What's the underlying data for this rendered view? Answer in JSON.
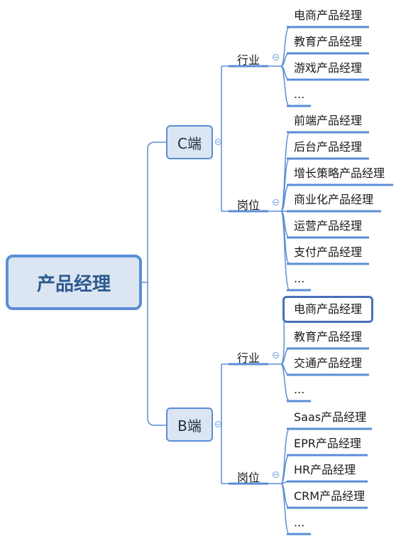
{
  "colors": {
    "line": "#5a8ed6",
    "node_fill": "#dce6f2",
    "root_text": "#2c5a8f",
    "selected_border": "#4a70b8"
  },
  "root": {
    "label": "产品经理"
  },
  "branches": [
    {
      "label": "C端",
      "groups": [
        {
          "label": "行业",
          "items": [
            "电商产品经理",
            "教育产品经理",
            "游戏产品经理",
            "..."
          ]
        },
        {
          "label": "岗位",
          "items": [
            "前端产品经理",
            "后台产品经理",
            "增长策略产品经理",
            "商业化产品经理",
            "运营产品经理",
            "支付产品经理",
            "..."
          ]
        }
      ]
    },
    {
      "label": "B端",
      "groups": [
        {
          "label": "行业",
          "items": [
            "电商产品经理",
            "教育产品经理",
            "交通产品经理",
            "..."
          ],
          "selected_index": 0
        },
        {
          "label": "岗位",
          "items": [
            "Saas产品经理",
            "EPR产品经理",
            "HR产品经理",
            "CRM产品经理",
            "..."
          ]
        }
      ]
    }
  ]
}
